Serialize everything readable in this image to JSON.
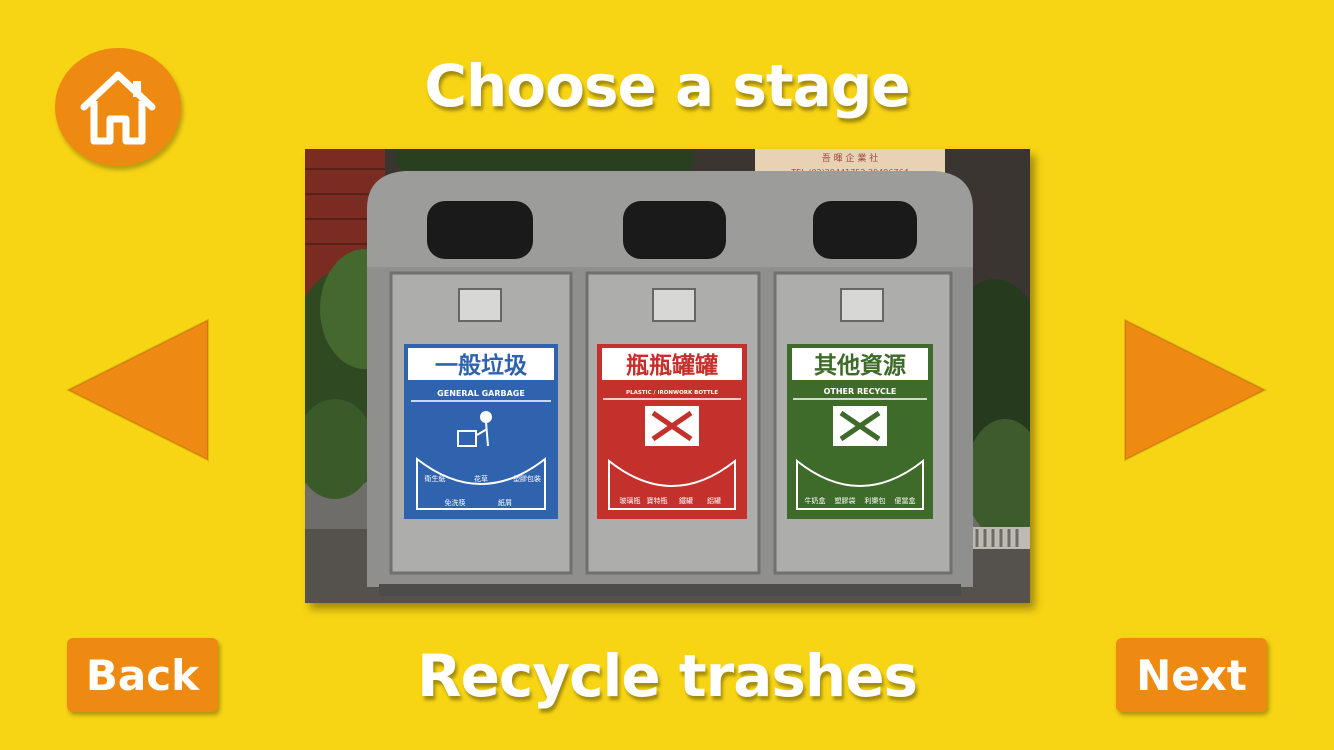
{
  "header": {
    "title": "Choose a stage"
  },
  "footer": {
    "stage_name": "Recycle trashes",
    "back_label": "Back",
    "next_label": "Next"
  },
  "nav": {
    "home_icon": "home-icon",
    "prev_icon": "left-triangle-icon",
    "next_icon": "right-triangle-icon"
  },
  "stage_image": {
    "box_label": "吾 暉 企 業 社",
    "box_phone": "TEL:(02)29441752 29496764",
    "bins": [
      {
        "title": "一般垃圾",
        "subtitle": "GENERAL GARBAGE",
        "items": [
          "衛生紙",
          "花草",
          "塑膠包裝",
          "免洗筷",
          "紙屑"
        ],
        "color": "#2F63AE"
      },
      {
        "title": "瓶瓶罐罐",
        "subtitle": "PLASTIC / IRONWORK BOTTLE",
        "items": [
          "玻璃瓶",
          "寶特瓶",
          "鐵罐",
          "鋁罐"
        ],
        "color": "#C4302B"
      },
      {
        "title": "其他資源",
        "subtitle": "OTHER RECYCLE",
        "items": [
          "牛奶盒",
          "塑膠袋",
          "利樂包",
          "便當盒"
        ],
        "color": "#3E6A2A"
      }
    ]
  },
  "colors": {
    "background": "#F7D414",
    "accent": "#EE8A12",
    "text": "#FFFFFF"
  }
}
